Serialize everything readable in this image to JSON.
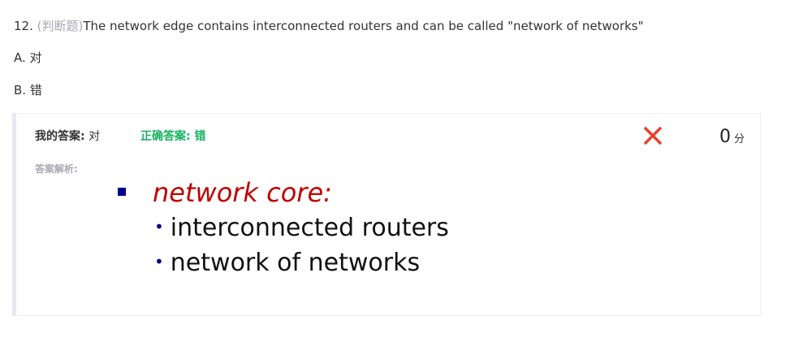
{
  "question": {
    "number": "12.",
    "type": "(判断题)",
    "text": "The network edge contains interconnected routers and can be called \"network of networks\""
  },
  "options": [
    {
      "label": "A. 对"
    },
    {
      "label": "B. 错"
    }
  ],
  "result": {
    "my_answer_label": "我的答案:",
    "my_answer_value": "对",
    "correct_answer_label": "正确答案:",
    "correct_answer_value": "错",
    "mark_icon": "cross-icon",
    "mark_color": "#e8412c",
    "score_value": "0",
    "score_unit": "分",
    "analysis_label": "答案解析:"
  },
  "slide": {
    "title": "network core:",
    "bullets": [
      "interconnected routers",
      "network of networks"
    ],
    "title_color": "#c00000",
    "bullet_color": "#00008b"
  },
  "colors": {
    "correct": "#14b35f",
    "muted": "#a8a8b3"
  }
}
